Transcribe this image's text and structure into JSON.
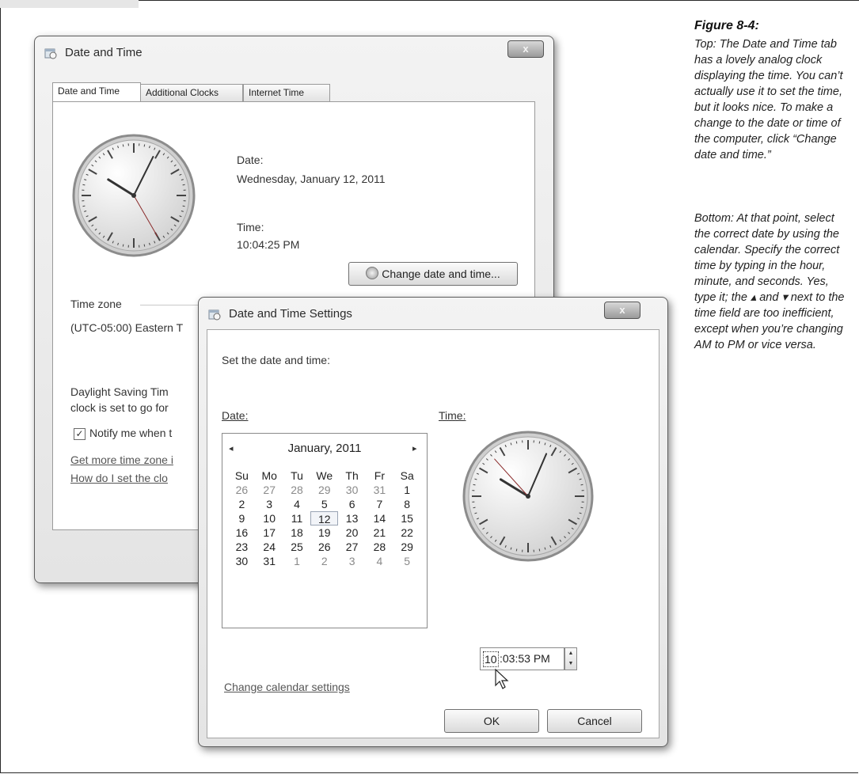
{
  "caption": {
    "title": "Figure 8-4:",
    "paragraph1": "Top: The Date and Time tab has a lovely analog clock displaying the time. You can’t actually use it to set the time, but it looks nice. To make a change to the date or time of the computer, click “Change date and time.”",
    "paragraph2": "Bottom: At that point, select the correct date by using the calendar. Specify the correct time by typing in the hour, minute, and seconds. Yes, type it; the ▴ and ▾ next to the time field are too inefficient, except when you’re changing AM to PM or vice versa."
  },
  "window1": {
    "title": "Date and Time",
    "close_label": "x",
    "tabs": [
      {
        "label": "Date and Time"
      },
      {
        "label": "Additional Clocks"
      },
      {
        "label": "Internet Time"
      }
    ],
    "date_label": "Date:",
    "date_value": "Wednesday, January 12, 2011",
    "time_label": "Time:",
    "time_value": "10:04:25 PM",
    "change_button": "Change date and time...",
    "timezone_label": "Time zone",
    "timezone_value": "(UTC-05:00) Eastern T",
    "dst_line1": "Daylight Saving Tim",
    "dst_line2": "clock is set to go for",
    "notify_label": "Notify me when t",
    "notify_checked": true,
    "link1": "Get more time zone i",
    "link2": "How do I set the clo",
    "clock": {
      "hour": 10,
      "minute": 4,
      "second": 25
    }
  },
  "window2": {
    "title": "Date and Time Settings",
    "close_label": "x",
    "heading": "Set the date and time:",
    "date_label": "Date:",
    "time_label": "Time:",
    "calendar": {
      "month": "January, 2011",
      "prev": "◂",
      "next": "▸",
      "weekdays": [
        "Su",
        "Mo",
        "Tu",
        "We",
        "Th",
        "Fr",
        "Sa"
      ],
      "weeks": [
        [
          "26",
          "27",
          "28",
          "29",
          "30",
          "31",
          "1"
        ],
        [
          "2",
          "3",
          "4",
          "5",
          "6",
          "7",
          "8"
        ],
        [
          "9",
          "10",
          "11",
          "12",
          "13",
          "14",
          "15"
        ],
        [
          "16",
          "17",
          "18",
          "19",
          "20",
          "21",
          "22"
        ],
        [
          "23",
          "24",
          "25",
          "26",
          "27",
          "28",
          "29"
        ],
        [
          "30",
          "31",
          "1",
          "2",
          "3",
          "4",
          "5"
        ]
      ],
      "selected": "12"
    },
    "time_hour": "10",
    "time_rest": ":03:53 PM",
    "spin_up": "▲",
    "spin_down": "▼",
    "change_calendar_link": "Change calendar settings",
    "ok_button": "OK",
    "cancel_button": "Cancel",
    "clock": {
      "hour": 10,
      "minute": 3,
      "second": 53
    }
  }
}
